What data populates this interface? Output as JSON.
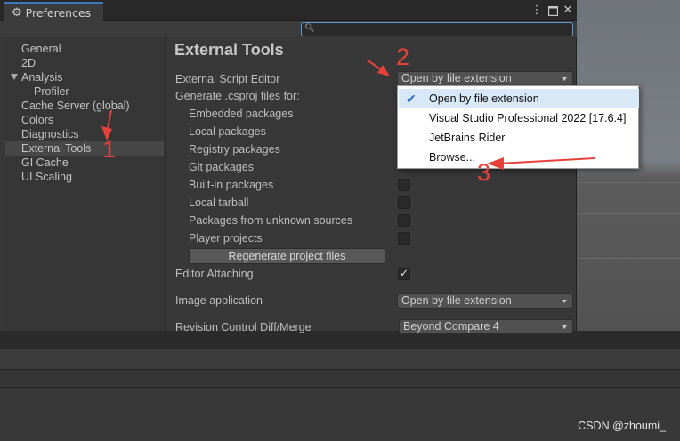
{
  "window": {
    "tab_title": "Preferences",
    "tab_icon": "gear-icon",
    "controls": [
      "more-icon",
      "maximize-icon",
      "close-icon"
    ]
  },
  "search": {
    "placeholder": "",
    "value": ""
  },
  "sidebar": {
    "items": [
      {
        "label": "General"
      },
      {
        "label": "2D"
      },
      {
        "label": "Analysis"
      },
      {
        "label": "Profiler"
      },
      {
        "label": "Cache Server (global)"
      },
      {
        "label": "Colors"
      },
      {
        "label": "Diagnostics"
      },
      {
        "label": "External Tools",
        "selected": true
      },
      {
        "label": "GI Cache"
      },
      {
        "label": "UI Scaling"
      }
    ]
  },
  "main": {
    "title": "External Tools",
    "external_script_editor": {
      "label": "External Script Editor",
      "value": "Open by file extension"
    },
    "generate_csproj_label": "Generate .csproj files for:",
    "csproj_options": [
      {
        "label": "Embedded packages",
        "checked": false
      },
      {
        "label": "Local packages",
        "checked": false
      },
      {
        "label": "Registry packages",
        "checked": false
      },
      {
        "label": "Git packages",
        "checked": false
      },
      {
        "label": "Built-in packages",
        "checked": false
      },
      {
        "label": "Local tarball",
        "checked": false
      },
      {
        "label": "Packages from unknown sources",
        "checked": false
      },
      {
        "label": "Player projects",
        "checked": false
      }
    ],
    "regenerate_button": "Regenerate project files",
    "editor_attaching": {
      "label": "Editor Attaching",
      "checked": true
    },
    "image_application": {
      "label": "Image application",
      "value": "Open by file extension"
    },
    "revision_control": {
      "label": "Revision Control Diff/Merge",
      "value": "Beyond Compare 4"
    }
  },
  "popup_menu": {
    "items": [
      {
        "label": "Open by file extension",
        "checked": true
      },
      {
        "label": "Visual Studio Professional 2022 [17.6.4]",
        "checked": false
      },
      {
        "label": "JetBrains Rider",
        "checked": false
      },
      {
        "label": "Browse...",
        "checked": false
      }
    ]
  },
  "annotations": {
    "numbers": [
      "1",
      "2",
      "3"
    ],
    "color": "#e8413a"
  },
  "watermark": "CSDN @zhoumi_",
  "colors": {
    "accent": "#3a79bb",
    "window_bg": "#383838",
    "selected_row": "#474747",
    "popup_highlight": "#d9e8f7"
  }
}
